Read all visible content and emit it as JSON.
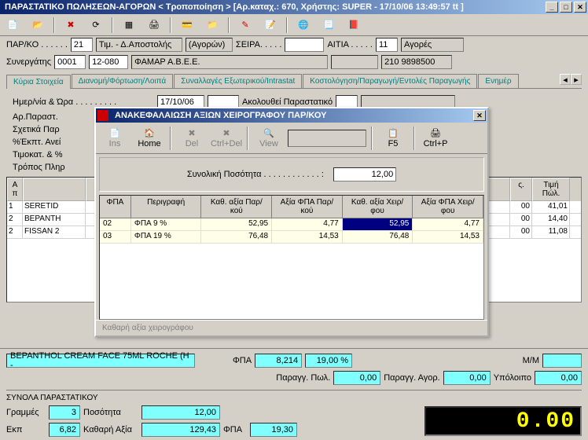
{
  "window": {
    "title": "ΠΑΡΑΣΤΑΤΙΚΟ ΠΩΛΗΣΕΩΝ-ΑΓΟΡΩΝ < Τροποποίηση > [Αρ.καταχ.: 670, Χρήστης: SUPER - 17/10/06 13:49:57 tt ]"
  },
  "form": {
    "parko_label": "ΠΑΡ/ΚΟ . . . . . .",
    "parko_code": "21",
    "parko_desc": "Τιμ. - Δ.Αποστολής",
    "parko_type": "(Αγορών)",
    "seira_label": "ΣΕΙΡΑ. . . . .",
    "aitia_label": "ΑΙΤΙΑ . . . . .",
    "aitia_code": "11",
    "aitia_desc": "Αγορές",
    "synerg_label": "Συνεργάτης",
    "synerg_code1": "0001",
    "synerg_code2": "12-080",
    "synerg_name": "ΦΑΜΑΡ Α.Β.Ε.Ε.",
    "synerg_phone": "210 9898500"
  },
  "tabs": {
    "items": [
      "Κύρια Στοιχεία",
      "Διανομή/Φόρτωση/Λοιπά",
      "Συναλλαγές Εξωτερικού/Intrastat",
      "Κοστολόγηση/Παραγωγή/Εντολές Παραγωγής",
      "Ενημέρ"
    ]
  },
  "subform": {
    "date_label": "Ημερ/νία & Ώρα . . . . . . . . .",
    "date_val": "17/10/06",
    "akol_label": "Ακολουθεί Παραστατικό",
    "arparast_label": "Αρ.Παραστ.",
    "sxetika_label": "Σχετικά Παρ",
    "ekpt_label": "%Έκπτ. Ανεί",
    "timokat_label": "Τιμοκατ. & %",
    "tropos_label": "Τρόπος Πληρ"
  },
  "modal": {
    "title": "ΑΝΑΚΕΦΑΛΑΙΩΣΗ ΑΞΙΩΝ ΧΕΙΡΟΓΡΑΦΟΥ ΠΑΡ/ΚΟΥ",
    "toolbar": {
      "ins": "Ins",
      "home": "Home",
      "del": "Del",
      "ctrldel": "Ctrl+Del",
      "view": "View",
      "f5": "F5",
      "ctrlp": "Ctrl+P"
    },
    "qty_label": "Συνολική Ποσότητα . . . . . . . . . . . . :",
    "qty_val": "12,00",
    "grid": {
      "headers": [
        "ΦΠΑ",
        "Περιγραφή",
        "Καθ. αξία Παρ/κού",
        "Αξία ΦΠΑ Παρ/κού",
        "Καθ. αξία Χειρ/φου",
        "Αξία ΦΠΑ Χειρ/φου"
      ],
      "rows": [
        {
          "code": "02",
          "desc": "ΦΠΑ 9 %",
          "kath_par": "52,95",
          "fpa_par": "4,77",
          "kath_xeir": "52,95",
          "fpa_xeir": "4,77"
        },
        {
          "code": "03",
          "desc": "ΦΠΑ 19 %",
          "kath_par": "76,48",
          "fpa_par": "14,53",
          "kath_xeir": "76,48",
          "fpa_xeir": "14,53"
        }
      ]
    },
    "footer_label": "Καθαρή αξία χειρογράφου"
  },
  "main_grid": {
    "headers": [
      "Α π",
      "",
      "ς.",
      "Τιμή Πώλ."
    ],
    "rows": [
      {
        "n": "1",
        "desc": "SERETID",
        "x": "00",
        "price": "41,01"
      },
      {
        "n": "2",
        "desc": "BEPANTH",
        "x": "00",
        "price": "14,40"
      },
      {
        "n": "2",
        "desc": "FISSAN 2",
        "x": "00",
        "price": "11,08"
      }
    ]
  },
  "bottom_bar": {
    "item_desc": "BEPANTHOL CREAM FACE 75ML ROCHE (H -",
    "fpa_label": "ΦΠΑ",
    "fpa_val": "8,214",
    "fpa_pct": "19,00 %",
    "mm_label": "M/M",
    "paragg_pol_label": "Παραγγ. Πωλ.",
    "paragg_pol_val": "0,00",
    "paragg_agor_label": "Παραγγ. Αγορ.",
    "paragg_agor_val": "0,00",
    "ypoloipo_label": "Υπόλοιπο",
    "ypoloipo_val": "0,00"
  },
  "totals": {
    "title": "ΣΥΝΟΛΑ ΠΑΡΑΣΤΑΤΙΚΟΥ",
    "grammes_label": "Γραμμές",
    "grammes_val": "3",
    "posotita_label": "Ποσότητα",
    "posotita_val": "12,00",
    "ekp_label": "Εκπ",
    "ekp_val": "6,82",
    "katharh_label": "Καθαρή Αξία",
    "katharh_val": "129,43",
    "fpa_label": "ΦΠΑ",
    "fpa_val": "19,30",
    "lcd": "0.00"
  }
}
